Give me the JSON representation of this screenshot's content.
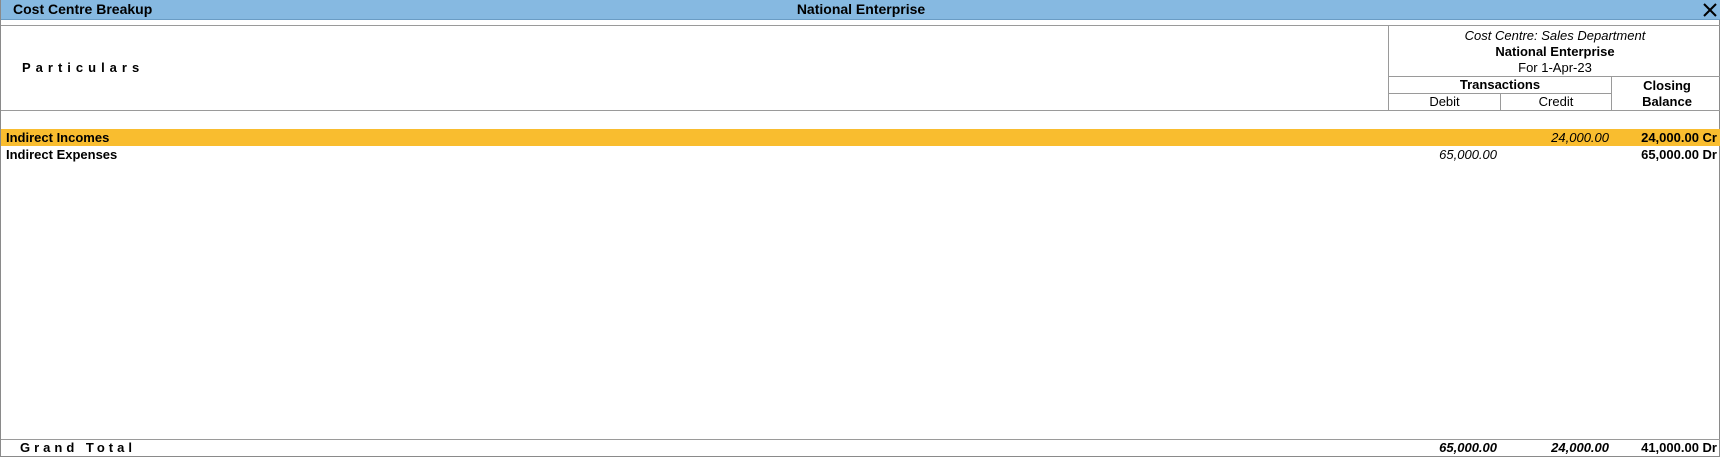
{
  "window": {
    "title": "Cost Centre Breakup",
    "company": "National Enterprise",
    "close_icon": "close-icon"
  },
  "header": {
    "particulars": "Particulars",
    "cost_centre": "Cost Centre: Sales Department",
    "company": "National Enterprise",
    "period": "For 1-Apr-23",
    "transactions": "Transactions",
    "debit": "Debit",
    "credit": "Credit",
    "closing_line1": "Closing",
    "closing_line2": "Balance"
  },
  "rows": [
    {
      "name": "Indirect Incomes",
      "debit": "",
      "credit": "24,000.00",
      "closing": "24,000.00 Cr",
      "selected": true
    },
    {
      "name": "Indirect Expenses",
      "debit": "65,000.00",
      "credit": "",
      "closing": "65,000.00 Dr",
      "selected": false
    }
  ],
  "grand_total": {
    "label": "Grand Total",
    "debit": "65,000.00",
    "credit": "24,000.00",
    "closing": "41,000.00 Dr"
  },
  "colors": {
    "titlebar": "#86b9e1",
    "selected_row": "#f9bd2f"
  }
}
